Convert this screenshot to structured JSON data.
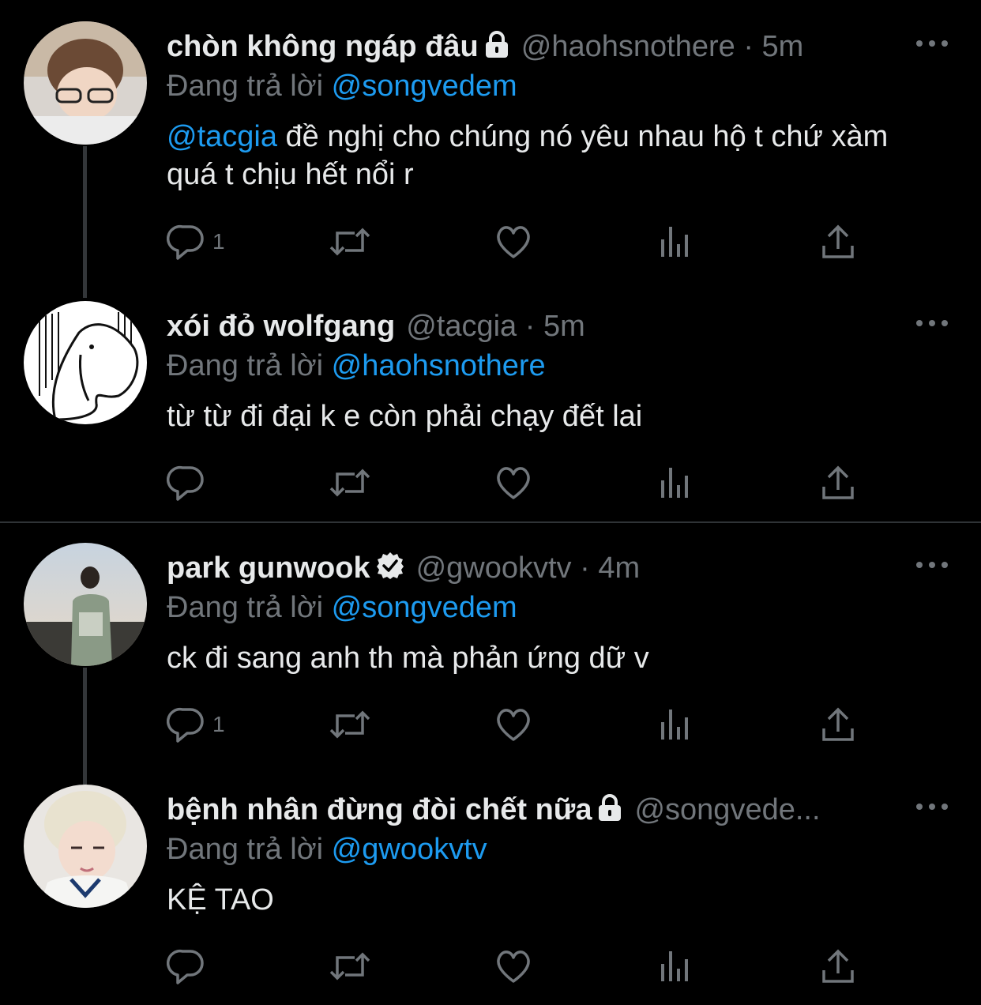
{
  "tweets": [
    {
      "display_name": "chòn không ngáp đâu",
      "badge": "lock-icon",
      "handle": "@haohsnothere",
      "separator": "·",
      "time": "5m",
      "replying_label": "Đang trả lời",
      "replying_to": "@songvedem",
      "text_mention": "@tacgia",
      "text": " đề nghị cho chúng nó yêu nhau hộ t chứ xàm quá t chịu hết nổi r",
      "reply_count": "1"
    },
    {
      "display_name": "xói đỏ wolfgang",
      "handle": "@tacgia",
      "separator": "·",
      "time": "5m",
      "replying_label": "Đang trả lời",
      "replying_to": "@haohsnothere",
      "text": "từ từ đi đại k e còn phải chạy đết lai",
      "reply_count": ""
    },
    {
      "display_name": "park gunwook",
      "badge": "verified-icon",
      "handle": "@gwookvtv",
      "separator": "·",
      "time": "4m",
      "replying_label": "Đang trả lời",
      "replying_to": "@songvedem",
      "text": "ck đi sang anh th mà phản ứng dữ v",
      "reply_count": "1"
    },
    {
      "display_name": "bệnh nhân đừng đòi chết nữa",
      "badge": "lock-icon",
      "handle": "@songvede...",
      "separator": "",
      "time": "",
      "replying_label": "Đang trả lời",
      "replying_to": "@gwookvtv",
      "text": "KỆ TAO",
      "reply_count": ""
    }
  ],
  "icons": {
    "reply": "reply-icon",
    "retweet": "retweet-icon",
    "like": "heart-icon",
    "views": "views-icon",
    "share": "share-icon",
    "more": "more-icon"
  },
  "colors": {
    "background": "#000000",
    "text": "#e7e9ea",
    "muted": "#71767b",
    "accent": "#1d9bf0",
    "line": "#333639"
  }
}
